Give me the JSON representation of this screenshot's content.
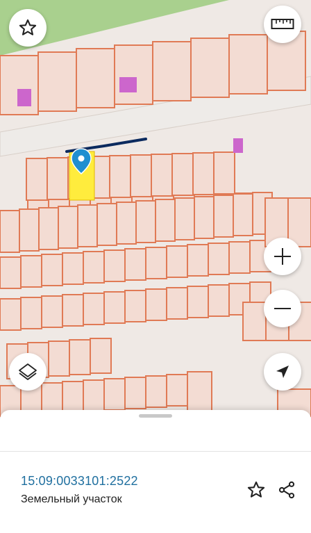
{
  "colors": {
    "map_bg": "#efe9e5",
    "parcel_stroke": "#e07a55",
    "parcel_fill": "#f3dcd3",
    "road_fill": "#eeebe8",
    "grass": "#a9d08e",
    "building": "#cc66cc",
    "selected_parcel": "#ffec3d",
    "measure_line": "#0b2a5e",
    "pin": "#1f8fd0",
    "link_text": "#1f6f9f"
  },
  "map": {
    "icons": [
      "star-icon",
      "ruler-icon",
      "zoom-in-icon",
      "zoom-out-icon",
      "layers-icon",
      "location-arrow-icon"
    ]
  },
  "sheet": {
    "cadastral_number": "15:09:0033101:2522",
    "parcel_type": "Земельный участок",
    "icons": [
      "star-outline-icon",
      "share-icon"
    ]
  }
}
